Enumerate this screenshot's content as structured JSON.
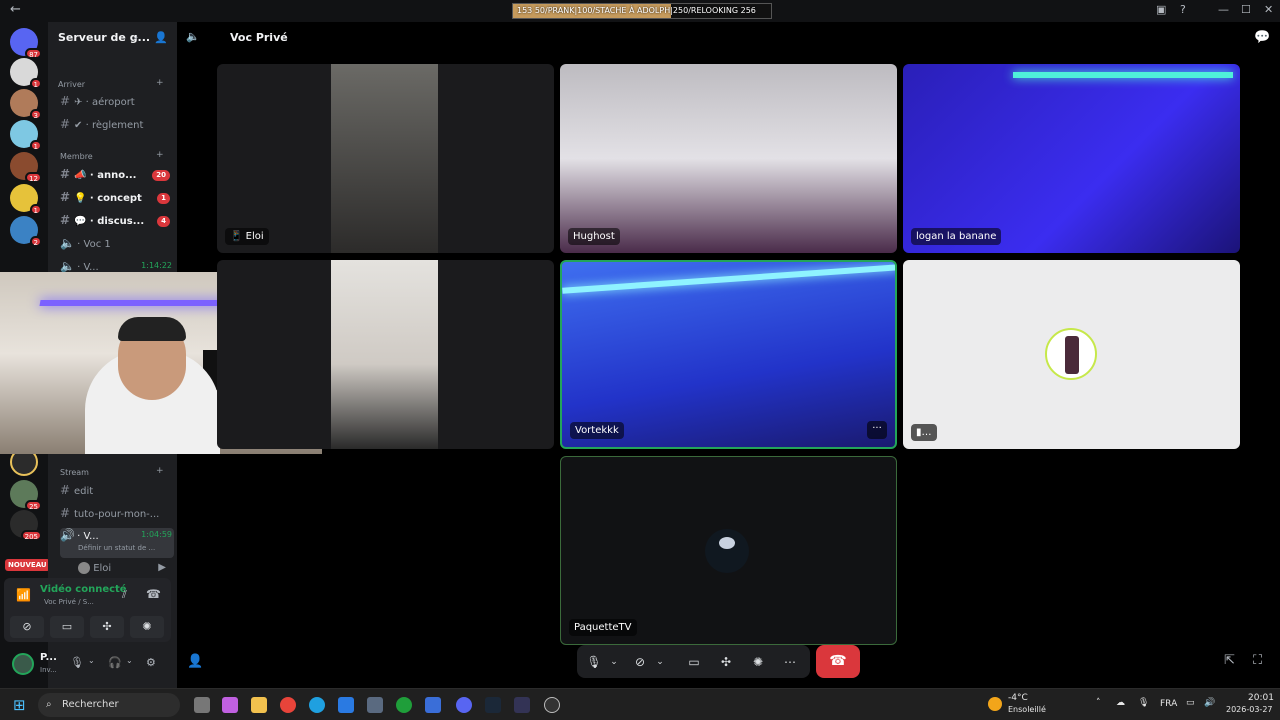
{
  "topbar": {
    "back_icon": "arrow-left-icon",
    "stream_title": "153          50/PRANK|100/STACHE À ADOLPH|250/RELOOKING 256"
  },
  "servers": {
    "top_badge": "87",
    "badges": [
      "1",
      "3",
      "1",
      "12",
      "1",
      "2"
    ],
    "lower_badges": [
      "25",
      "205"
    ],
    "new_label": "NOUVEAU"
  },
  "sidebar": {
    "server_name": "Serveur de g...",
    "categories": {
      "arriver": "Arriver",
      "membre": "Membre",
      "stream": "Stream"
    },
    "channels": [
      {
        "label": "aéroport",
        "emoji": "✈",
        "badge": ""
      },
      {
        "label": "règlement",
        "emoji": "✔",
        "badge": ""
      },
      {
        "label": "anno...",
        "emoji": "📣",
        "badge": "20"
      },
      {
        "label": "concept",
        "emoji": "💡",
        "badge": "1"
      },
      {
        "label": "discus...",
        "emoji": "💬",
        "badge": "4"
      }
    ],
    "voice1": "Voc 1",
    "voice2": "V...",
    "voice2_time": "1:14:22",
    "stream_channels": [
      "edit",
      "tuto-pour-mon-..."
    ],
    "active_voice": "V...",
    "active_voice_time": "1:04:59",
    "active_voice_sub": "Définir un statut de ...",
    "member_name": "Eloi"
  },
  "voice_panel": {
    "status": "Vidéo connecté",
    "sub": "Voc Privé / S..."
  },
  "user_panel": {
    "name": "P...",
    "status": "Inv..."
  },
  "header": {
    "title": "Voc Privé"
  },
  "tiles": {
    "eloi": "Eloi",
    "hughost": "Hughost",
    "logan": "logan la banane",
    "vortekkk": "Vortekkk",
    "paquette": "PaquetteTV",
    "more_label": "···"
  },
  "taskbar": {
    "search": "Rechercher",
    "weather_temp": "-4°C",
    "weather_desc": "Ensoleillé",
    "lang": "FRA",
    "time": "20:01",
    "date": "2026-03-27"
  },
  "colors": {
    "accent_green": "#23a55a",
    "danger": "#da373c",
    "bg_dark": "#1e1f22"
  }
}
